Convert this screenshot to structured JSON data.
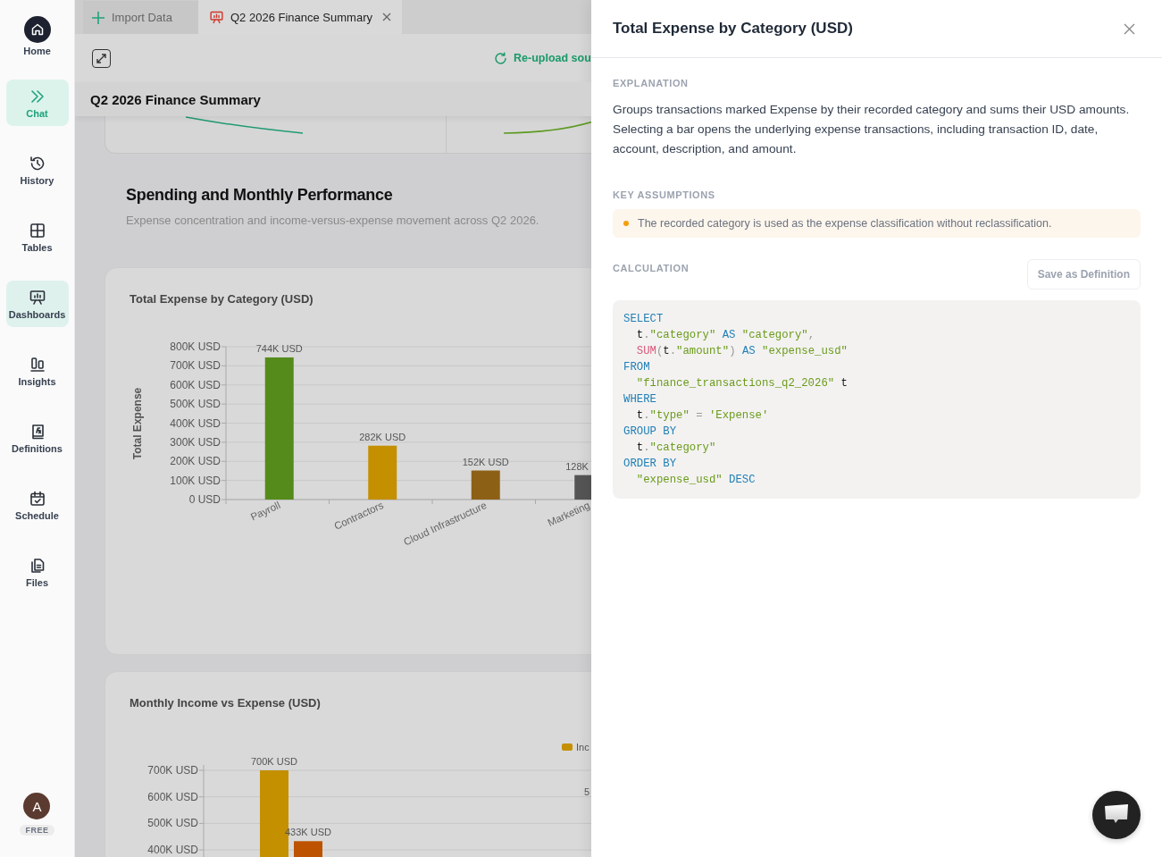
{
  "sidebar": {
    "items": [
      {
        "label": "Home",
        "active": false,
        "selected": false
      },
      {
        "label": "Chat",
        "active": true,
        "selected": false
      },
      {
        "label": "History",
        "active": false,
        "selected": false
      },
      {
        "label": "Tables",
        "active": false,
        "selected": false
      },
      {
        "label": "Dashboards",
        "active": false,
        "selected": true
      },
      {
        "label": "Insights",
        "active": false,
        "selected": false
      },
      {
        "label": "Definitions",
        "active": false,
        "selected": false
      },
      {
        "label": "Schedule",
        "active": false,
        "selected": false
      },
      {
        "label": "Files",
        "active": false,
        "selected": false
      }
    ],
    "account": {
      "avatar": "A",
      "plan": "FREE"
    }
  },
  "tabs": [
    {
      "label": "Import Data",
      "selected": false,
      "closable": false
    },
    {
      "label": "Q2 2026 Finance Summary",
      "selected": true,
      "closable": true
    }
  ],
  "toolbar": {
    "reupload": "Re-upload sou"
  },
  "dashboard": {
    "title": "Q2 2026 Finance Summary",
    "section": {
      "heading": "Spending and Monthly Performance",
      "subtitle": "Expense concentration and income-versus-expense movement across Q2 2026."
    },
    "cards": [
      {
        "chart_data": {
          "type": "bar",
          "grid": true,
          "title": "Total Expense by Category (USD)",
          "ylabel": "Total Expense",
          "categories": [
            "Payroll",
            "Contractors",
            "Cloud Infrastructure",
            "Marketing"
          ],
          "values": [
            744000,
            282000,
            152000,
            128000
          ],
          "colors": [
            "#558b1a",
            "#c49000",
            "#8c6116",
            "#555555"
          ],
          "ylim": [
            0,
            800000
          ],
          "yticks": [
            {
              "value": 0,
              "label": "0 USD"
            },
            {
              "value": 100000,
              "label": "100K USD"
            },
            {
              "value": 200000,
              "label": "200K USD"
            },
            {
              "value": 300000,
              "label": "300K USD"
            },
            {
              "value": 400000,
              "label": "400K USD"
            },
            {
              "value": 500000,
              "label": "500K USD"
            },
            {
              "value": 600000,
              "label": "600K USD"
            },
            {
              "value": 700000,
              "label": "700K USD"
            },
            {
              "value": 800000,
              "label": "800K USD"
            }
          ],
          "value_labels": [
            "744K USD",
            "282K USD",
            "152K USD",
            "128K"
          ]
        }
      },
      {
        "chart_data": {
          "type": "bar",
          "grid": true,
          "title": "Monthly Income vs Expense (USD)",
          "ylim": [
            0,
            700000
          ],
          "series": [
            {
              "name": "Inc",
              "color": "#c49000",
              "values": [
                700000
              ],
              "value_labels": [
                "700K USD"
              ]
            },
            {
              "color": "#bd5200",
              "values": [
                433000
              ],
              "value_labels": [
                "433K USD"
              ]
            }
          ],
          "yticks": [
            {
              "value": 400000,
              "label": "400K USD"
            },
            {
              "value": 500000,
              "label": "500K USD"
            },
            {
              "value": 600000,
              "label": "600K USD"
            },
            {
              "value": 700000,
              "label": "700K USD"
            }
          ],
          "annotations": [
            "5"
          ]
        }
      }
    ]
  },
  "drawer": {
    "title": "Total Expense by Category (USD)",
    "explanation_label": "EXPLANATION",
    "explanation": "Groups transactions marked Expense by their recorded category and sums their USD amounts. Selecting a bar opens the underlying expense transactions, including transaction ID, date, account, description, and amount.",
    "assumptions_label": "KEY ASSUMPTIONS",
    "assumptions": [
      "The recorded category is used as the expense classification without reclassification."
    ],
    "calculation_label": "CALCULATION",
    "save_button": "Save as Definition",
    "code": [
      [
        {
          "kind": "keyword",
          "text": "SELECT"
        }
      ],
      [
        {
          "kind": "ident",
          "text": "  t"
        },
        {
          "kind": "punct",
          "text": "."
        },
        {
          "kind": "string",
          "text": "\"category\" "
        },
        {
          "kind": "keyword",
          "text": "AS "
        },
        {
          "kind": "string",
          "text": "\"category\""
        },
        {
          "kind": "punct",
          "text": ","
        }
      ],
      [
        {
          "kind": "function",
          "text": "  SUM"
        },
        {
          "kind": "punct",
          "text": "("
        },
        {
          "kind": "ident",
          "text": "t"
        },
        {
          "kind": "punct",
          "text": "."
        },
        {
          "kind": "string",
          "text": "\"amount\""
        },
        {
          "kind": "punct",
          "text": ") "
        },
        {
          "kind": "keyword",
          "text": "AS "
        },
        {
          "kind": "string",
          "text": "\"expense_usd\""
        }
      ],
      [
        {
          "kind": "keyword",
          "text": "FROM"
        }
      ],
      [
        {
          "kind": "string",
          "text": "  \"finance_transactions_q2_2026\""
        },
        {
          "kind": "ident",
          "text": " t"
        }
      ],
      [
        {
          "kind": "keyword",
          "text": "WHERE"
        }
      ],
      [
        {
          "kind": "ident",
          "text": "  t"
        },
        {
          "kind": "punct",
          "text": "."
        },
        {
          "kind": "string",
          "text": "\"type\" "
        },
        {
          "kind": "punct",
          "text": "= "
        },
        {
          "kind": "string",
          "text": "'Expense'"
        }
      ],
      [
        {
          "kind": "keyword",
          "text": "GROUP BY"
        }
      ],
      [
        {
          "kind": "ident",
          "text": "  t"
        },
        {
          "kind": "punct",
          "text": "."
        },
        {
          "kind": "string",
          "text": "\"category\""
        }
      ],
      [
        {
          "kind": "keyword",
          "text": "ORDER BY"
        }
      ],
      [
        {
          "kind": "string",
          "text": "  \"expense_usd\" "
        },
        {
          "kind": "keyword",
          "text": "DESC"
        }
      ]
    ]
  }
}
